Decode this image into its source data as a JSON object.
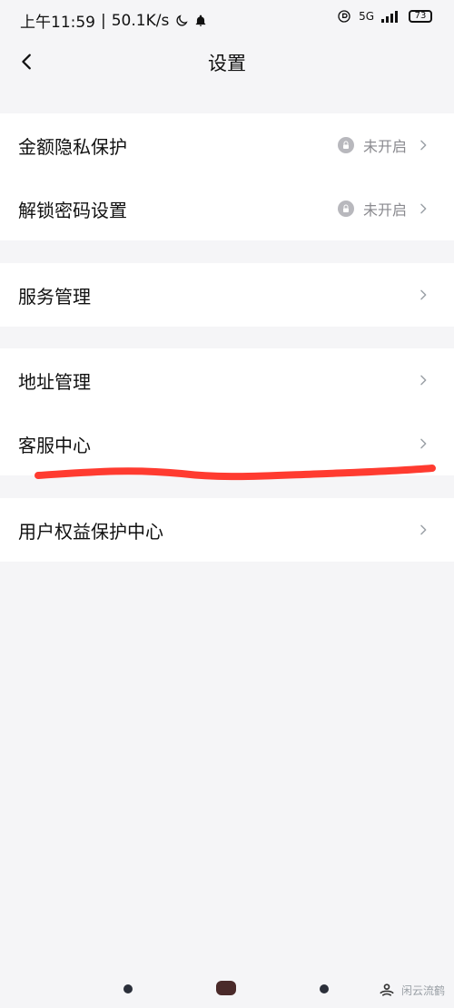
{
  "status_bar": {
    "time": "上午11:59",
    "speed": "50.1K/s",
    "network": "5G",
    "battery": "73"
  },
  "header": {
    "title": "设置"
  },
  "sections": [
    {
      "items": [
        {
          "label": "金额隐私保护",
          "status": "未开启"
        },
        {
          "label": "解锁密码设置",
          "status": "未开启"
        }
      ]
    },
    {
      "items": [
        {
          "label": "服务管理"
        }
      ]
    },
    {
      "items": [
        {
          "label": "地址管理"
        },
        {
          "label": "客服中心"
        }
      ]
    },
    {
      "items": [
        {
          "label": "用户权益保护中心"
        }
      ]
    }
  ],
  "watermark": "闲云流鹤",
  "colors": {
    "background": "#f5f5f7",
    "card": "#ffffff",
    "text": "#111111",
    "secondary_text": "#8a8a8f",
    "chevron": "#9aa0a6",
    "annotation": "#ff3b30"
  },
  "icons": {
    "back": "chevron-left-icon",
    "row_chevron": "chevron-right-icon",
    "lock": "lock-icon"
  }
}
